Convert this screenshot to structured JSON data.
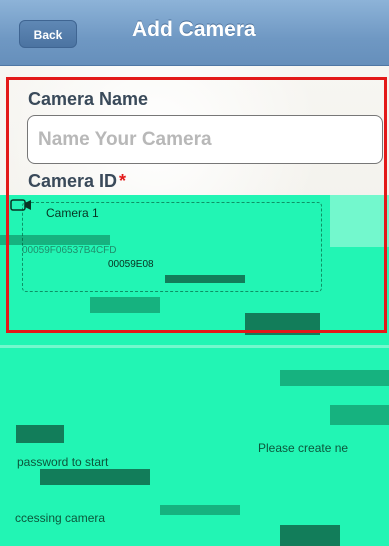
{
  "header": {
    "back_label": "Back",
    "title": "Add Camera"
  },
  "form": {
    "camera_name_label": "Camera Name",
    "camera_name_placeholder": "Name Your Camera",
    "camera_id_label": "Camera ID",
    "required_mark": "*"
  },
  "device_list": {
    "items": [
      {
        "name": "Camera 1",
        "id_primary": "00059F06537B4CFD",
        "id_secondary": "00059E08"
      }
    ]
  },
  "messages": {
    "line1": "Please create ne",
    "line2": "password to start",
    "line3": "ccessing camera"
  },
  "colors": {
    "header_blue": "#6f98c3",
    "highlight_red": "#e31919",
    "glitch_cyan": "#22f5b4"
  },
  "icons": {
    "back": "chevron-left-icon",
    "device": "camera-icon"
  }
}
